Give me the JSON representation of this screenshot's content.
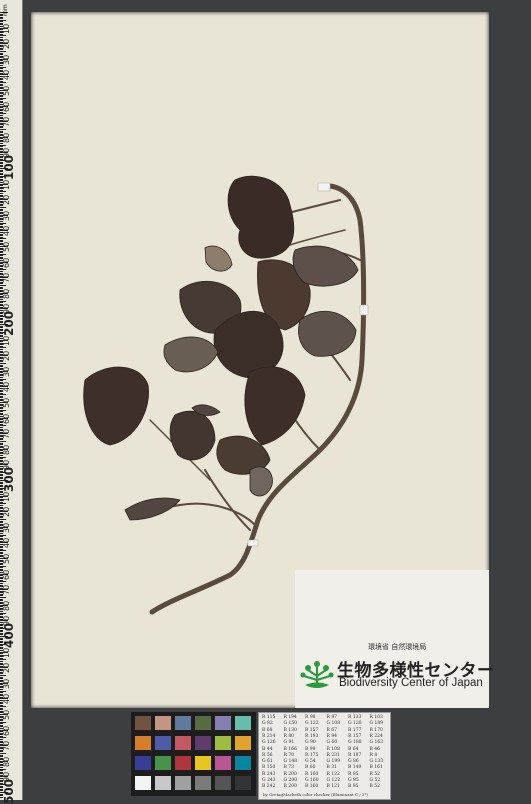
{
  "ruler": {
    "unit": "mm",
    "major_labels": [
      "100",
      "200",
      "300",
      "400",
      "500"
    ],
    "minor_labels": [
      "10",
      "20",
      "30",
      "40",
      "50",
      "60",
      "70",
      "80",
      "90"
    ]
  },
  "institution": {
    "agency_jp": "環境省 自然環境局",
    "name_jp": "生物多様性センター",
    "name_en": "Biodiversity Center of Japan"
  },
  "color_table": {
    "rows": [
      [
        "R 115",
        "R 194",
        "R 98",
        "R 87",
        "R 133",
        "R 103"
      ],
      [
        "G 82",
        "G 150",
        "G 122",
        "G 108",
        "G 128",
        "G 189"
      ],
      [
        "B 68",
        "B 130",
        "B 157",
        "B 67",
        "B 177",
        "B 170"
      ],
      [
        "R 214",
        "R 80",
        "R 193",
        "R 94",
        "R 157",
        "R 224"
      ],
      [
        "G 126",
        "G 91",
        "G 90",
        "G 60",
        "G 188",
        "G 163"
      ],
      [
        "B 44",
        "B 166",
        "B 99",
        "B 108",
        "B 64",
        "B 46"
      ],
      [
        "R 56",
        "R 70",
        "R 175",
        "R 231",
        "R 187",
        "R 8"
      ],
      [
        "G 61",
        "G 148",
        "G 54",
        "G 199",
        "G 86",
        "G 133"
      ],
      [
        "B 150",
        "B 73",
        "B 60",
        "B 31",
        "B 149",
        "B 161"
      ],
      [
        "R 243",
        "R 200",
        "R 160",
        "R 122",
        "R 85",
        "R 52"
      ],
      [
        "G 243",
        "G 200",
        "G 160",
        "G 122",
        "G 85",
        "G 52"
      ],
      [
        "B 242",
        "B 200",
        "B 160",
        "B 121",
        "B 85",
        "B 52"
      ]
    ],
    "footnote": "by GretagMacbeth color checker (Illuminant C / 2°)"
  },
  "checker_colors": [
    "#73523f",
    "#c29682",
    "#627a9d",
    "#576c43",
    "#8580b1",
    "#67bdaa",
    "#d67e2c",
    "#505ba6",
    "#c15a63",
    "#5e3c6c",
    "#9dbc40",
    "#e0a32e",
    "#383d96",
    "#469449",
    "#af363c",
    "#e7c71f",
    "#bb5695",
    "#0885a1",
    "#f3f3f2",
    "#c8c8c8",
    "#a0a0a0",
    "#7a7a79",
    "#555555",
    "#343434"
  ]
}
